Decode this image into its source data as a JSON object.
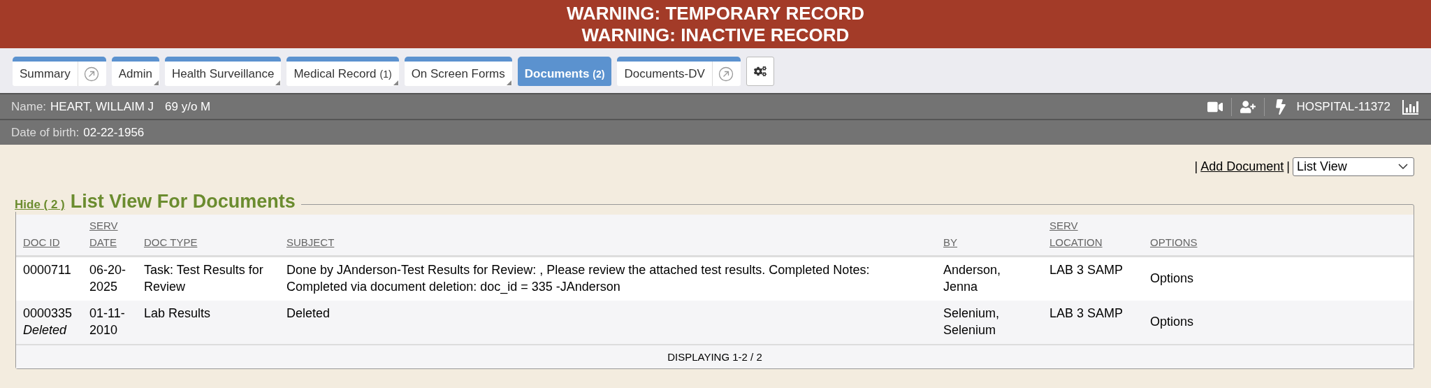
{
  "warnings": [
    "WARNING: TEMPORARY RECORD",
    "WARNING: INACTIVE RECORD"
  ],
  "tabs": [
    {
      "label": "Summary",
      "kind": "link",
      "selected": false
    },
    {
      "label": "Admin",
      "kind": "menu",
      "selected": false
    },
    {
      "label": "Health Surveillance",
      "kind": "menu",
      "selected": false
    },
    {
      "label": "Medical Record",
      "count": "(1)",
      "kind": "menu",
      "selected": false
    },
    {
      "label": "On Screen Forms",
      "kind": "menu",
      "selected": false
    },
    {
      "label": "Documents",
      "count": "(2)",
      "kind": "plain",
      "selected": true
    },
    {
      "label": "Documents-DV",
      "kind": "link",
      "selected": false
    }
  ],
  "patient": {
    "name_label": "Name:",
    "name": "HEART, WILLAIM J",
    "age": "69 y/o M",
    "dob_label": "Date of birth:",
    "dob": "02-22-1956",
    "hospital_id": "HOSPITAL-11372"
  },
  "actions": {
    "separator_left": "|",
    "add_document": "Add Document",
    "separator_right": "|",
    "view": "List View"
  },
  "section": {
    "hide_link": "Hide ( 2 )",
    "title": "List View For Documents"
  },
  "table": {
    "columns": [
      {
        "lines": [
          "DOC ID"
        ]
      },
      {
        "lines": [
          "SERV",
          "DATE"
        ]
      },
      {
        "lines": [
          "DOC TYPE"
        ]
      },
      {
        "lines": [
          "SUBJECT"
        ]
      },
      {
        "lines": [
          "BY"
        ]
      },
      {
        "lines": [
          "SERV",
          "LOCATION"
        ]
      },
      {
        "lines": [
          "OPTIONS"
        ]
      }
    ],
    "rows": [
      {
        "doc_id": "0000711",
        "serv_date": "06-20-2025",
        "doc_type": "Task: Test Results for Review",
        "subject": "Done by JAnderson-Test Results for Review: , Please review the attached test results. Completed Notes: Completed via document deletion: doc_id = 335 -JAnderson",
        "by": "Anderson, Jenna",
        "location": "LAB 3 SAMP",
        "options": "Options"
      },
      {
        "doc_id": "0000335",
        "status": "Deleted",
        "serv_date": "01-11-2010",
        "doc_type": "Lab Results",
        "subject": "Deleted",
        "by": "Selenium, Selenium",
        "location": "LAB 3 SAMP",
        "options": "Options"
      }
    ],
    "footer": "DISPLAYING 1-2 / 2"
  }
}
